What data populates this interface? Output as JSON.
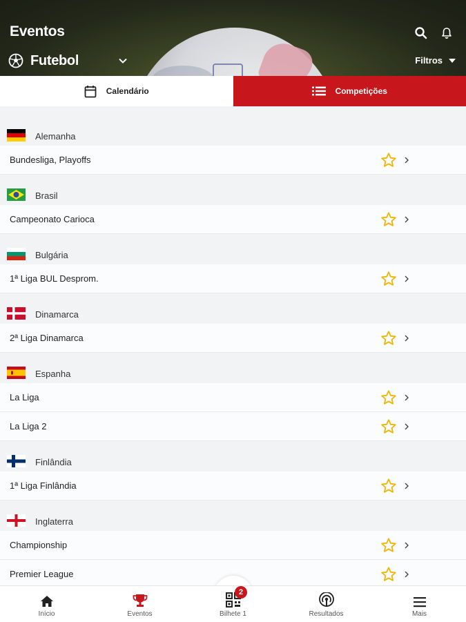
{
  "header": {
    "title": "Eventos",
    "sport": "Futebol",
    "filters_label": "Filtros",
    "icons": [
      "search-icon",
      "bell-icon",
      "soccer-ball-icon",
      "chevron-down-icon",
      "caret-down-icon"
    ]
  },
  "tabs": [
    {
      "label": "Calendário",
      "icon": "calendar-icon",
      "active": false
    },
    {
      "label": "Competições",
      "icon": "list-icon",
      "active": true
    }
  ],
  "groups": [
    {
      "country": "Alemanha",
      "flag": "germany",
      "leagues": [
        "Bundesliga, Playoffs"
      ]
    },
    {
      "country": "Brasil",
      "flag": "brazil",
      "leagues": [
        "Campeonato Carioca"
      ]
    },
    {
      "country": "Bulgária",
      "flag": "bulgaria",
      "leagues": [
        "1ª Liga BUL Desprom."
      ]
    },
    {
      "country": "Dinamarca",
      "flag": "denmark",
      "leagues": [
        "2ª Liga Dinamarca"
      ]
    },
    {
      "country": "Espanha",
      "flag": "spain",
      "leagues": [
        "La Liga",
        "La Liga 2"
      ]
    },
    {
      "country": "Finlândia",
      "flag": "finland",
      "leagues": [
        "1ª Liga Finlândia"
      ]
    },
    {
      "country": "Inglaterra",
      "flag": "england",
      "leagues": [
        "Championship",
        "Premier League"
      ]
    }
  ],
  "bottom_nav": [
    {
      "label": "Início",
      "icon": "home-icon"
    },
    {
      "label": "Eventos",
      "icon": "trophy-icon"
    },
    {
      "label": "Bilhete 1",
      "icon": "qr-ticket-icon",
      "badge": "2"
    },
    {
      "label": "Resultados",
      "icon": "broadcast-icon"
    },
    {
      "label": "Mais",
      "icon": "menu-icon"
    }
  ],
  "colors": {
    "accent": "#c8161d",
    "star": "#f0b400",
    "header_bg": "#23281a"
  }
}
